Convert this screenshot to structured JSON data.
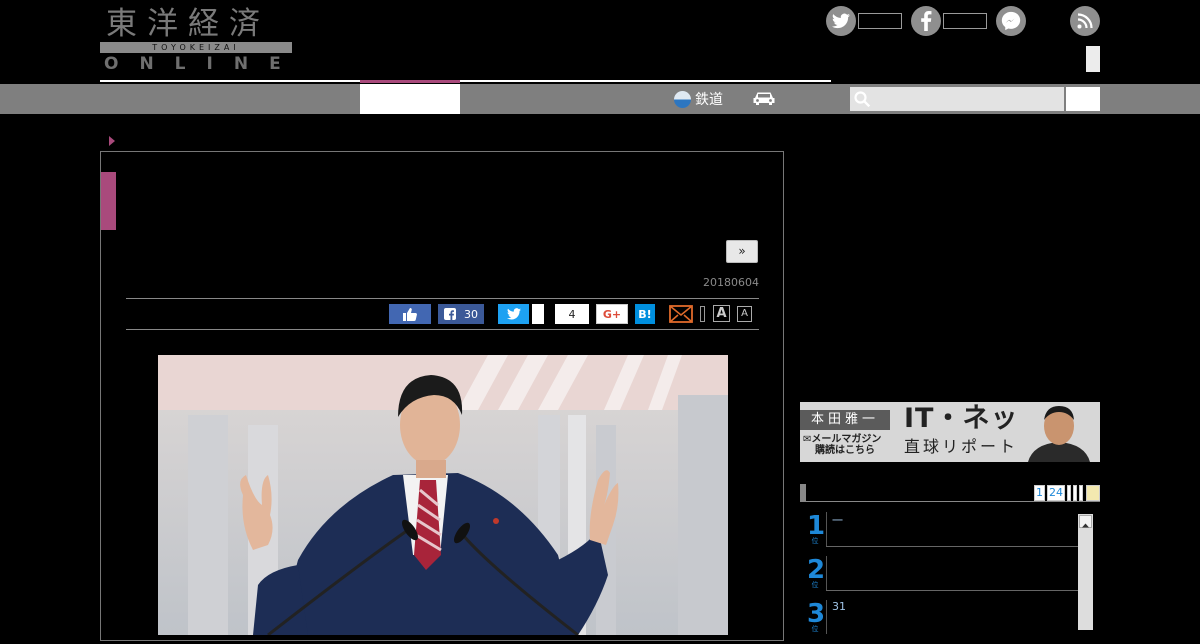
{
  "header": {
    "logo": {
      "kanji": "東洋経済",
      "romaji": "TOYOKEIZAI",
      "online": "ONLINE"
    },
    "social_icons": [
      "twitter-icon",
      "facebook-icon",
      "messenger-icon",
      "rss-icon"
    ],
    "nav": {
      "rail_label": "鉄道",
      "rail_icon": "train-icon",
      "car_icon": "car-icon"
    },
    "search": {
      "icon": "search-icon",
      "value": ""
    }
  },
  "article": {
    "next_label": "»",
    "date": "20180604",
    "share": {
      "facebook_count": "30",
      "pocket_count": "4",
      "google_plus": "G+",
      "hatena": "B!",
      "font_large": "A",
      "font_small": "A"
    }
  },
  "sidebar": {
    "banner": {
      "author": "本田雅一",
      "mail_line_1": "メールマガジン",
      "mail_line_2": "購読はこちら",
      "title": "IT・ネット",
      "subtitle": "直球リポート"
    },
    "ranking": {
      "tabs": [
        "1",
        "24"
      ],
      "rows": [
        {
          "rank": "1",
          "text": "一"
        },
        {
          "rank": "2",
          "text": ""
        },
        {
          "rank": "3",
          "text": "31"
        }
      ]
    }
  },
  "colors": {
    "accent": "#a94a7c",
    "nav_gray": "#7f7f7f",
    "rank_blue": "#1e88d8"
  }
}
